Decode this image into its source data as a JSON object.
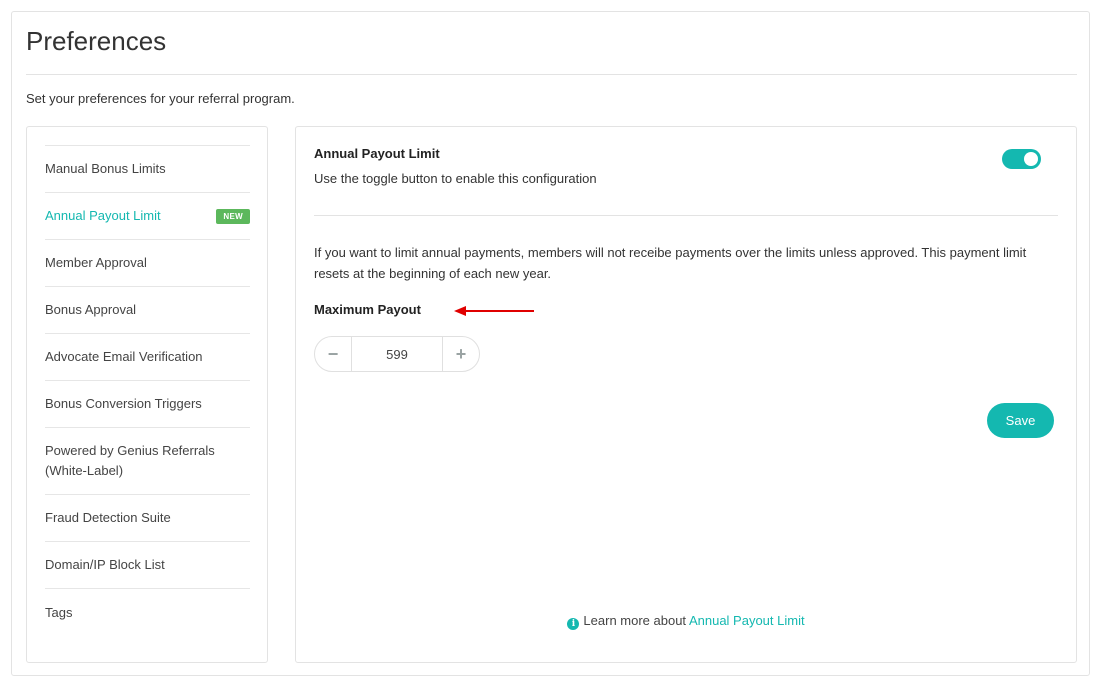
{
  "page": {
    "title": "Preferences",
    "subtitle": "Set your preferences for your referral program."
  },
  "sidebar": {
    "items": [
      {
        "label": "Manual Bonus Limits"
      },
      {
        "label": "Annual Payout Limit",
        "active": true,
        "badge": "NEW"
      },
      {
        "label": "Member Approval"
      },
      {
        "label": "Bonus Approval"
      },
      {
        "label": "Advocate Email Verification"
      },
      {
        "label": "Bonus Conversion Triggers"
      },
      {
        "label": "Powered by Genius Referrals (White-Label)"
      },
      {
        "label": "Fraud Detection Suite"
      },
      {
        "label": "Domain/IP Block List"
      },
      {
        "label": "Tags"
      }
    ]
  },
  "panel": {
    "heading": "Annual Payout Limit",
    "toggle_hint": "Use the toggle button to enable this configuration",
    "toggle_enabled": true,
    "description": "If you want to limit annual payments, members will not receibe payments over the limits unless approved. This payment limit resets at the beginning of each new year.",
    "field_label": "Maximum Payout",
    "stepper": {
      "value": "599",
      "minus": "−",
      "plus": "+"
    },
    "save_label": "Save",
    "learn_more_prefix": "Learn more about",
    "learn_more_link": "Annual Payout Limit"
  },
  "icons": {
    "info": "info-circle-icon",
    "arrow": "red-arrow-left-icon"
  },
  "colors": {
    "accent": "#14b8b0",
    "badge": "#5cb85c",
    "annotation_arrow": "#e00000"
  }
}
